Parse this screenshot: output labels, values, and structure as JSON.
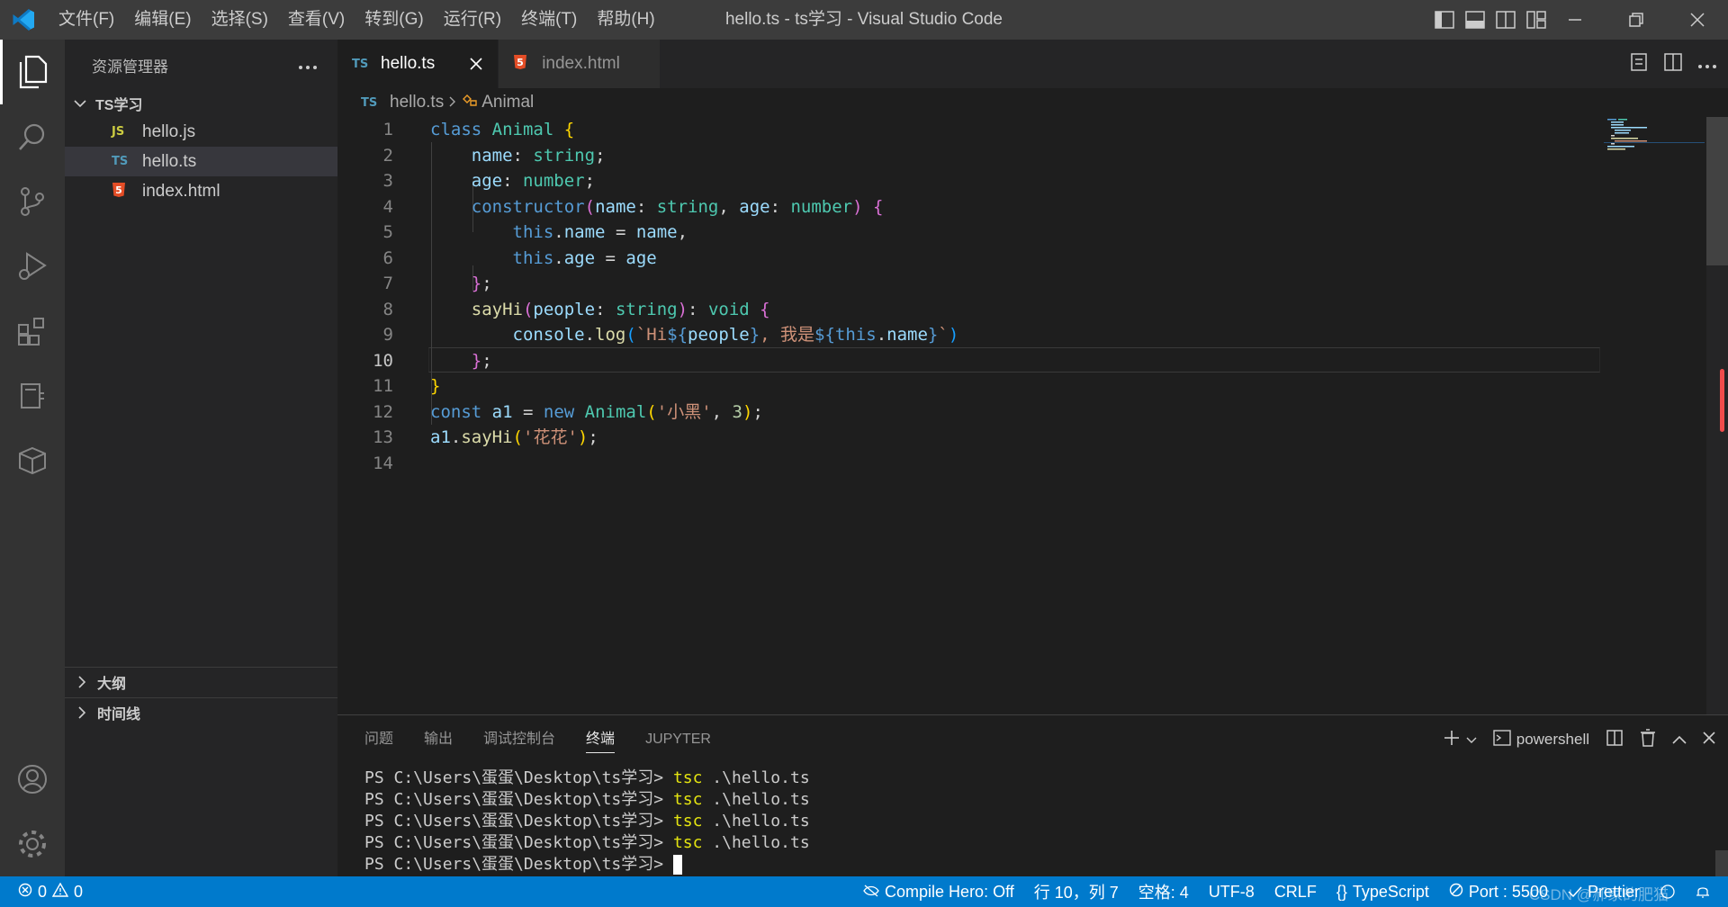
{
  "window": {
    "title": "hello.ts - ts学习 - Visual Studio Code",
    "menu": [
      "文件(F)",
      "编辑(E)",
      "选择(S)",
      "查看(V)",
      "转到(G)",
      "运行(R)",
      "终端(T)",
      "帮助(H)"
    ]
  },
  "sidebar": {
    "title": "资源管理器",
    "folder": "TS学习",
    "files": [
      {
        "badge": "JS",
        "name": "hello.js"
      },
      {
        "badge": "TS",
        "name": "hello.ts"
      },
      {
        "badge": "5",
        "name": "index.html"
      }
    ],
    "sections": [
      "大纲",
      "时间线"
    ]
  },
  "tabs": [
    {
      "badge": "TS",
      "label": "hello.ts"
    },
    {
      "badge": "5",
      "label": "index.html"
    }
  ],
  "breadcrumb": {
    "badge": "TS",
    "file": "hello.ts",
    "symbol": "Animal"
  },
  "editor": {
    "current_line": 10,
    "line_numbers": [
      "1",
      "2",
      "3",
      "4",
      "5",
      "6",
      "7",
      "8",
      "9",
      "10",
      "11",
      "12",
      "13",
      "14"
    ]
  },
  "panel": {
    "tabs": [
      "问题",
      "输出",
      "调试控制台",
      "终端",
      "JUPYTER"
    ],
    "active_tab": "终端",
    "shell": "powershell",
    "prompt": "PS C:\\Users\\蛋蛋\\Desktop\\ts学习> ",
    "command": "tsc",
    "arg": " .\\hello.ts"
  },
  "statusbar": {
    "errors": "0",
    "warnings": "0",
    "compile_hero": "Compile Hero: Off",
    "position": "行 10，列 7",
    "spaces": "空格: 4",
    "encoding": "UTF-8",
    "eol": "CRLF",
    "language": "TypeScript",
    "port": "Port : 5500",
    "prettier": "Prettier",
    "watermark": "CSDN @郝家的肥猫"
  },
  "colors": {
    "accent": "#007acc",
    "ts_badge": "#519aba",
    "js_badge": "#cbcb41",
    "html_badge": "#e44d26"
  }
}
